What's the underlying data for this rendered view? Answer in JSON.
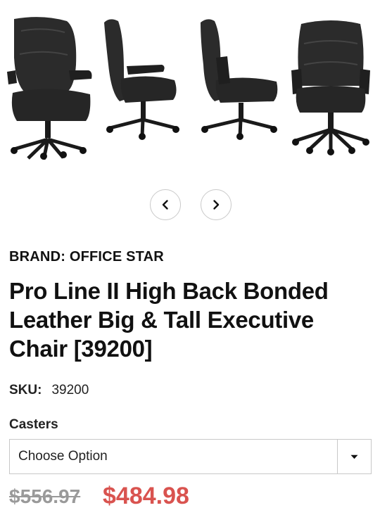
{
  "gallery": {
    "images": [
      {
        "name": "chair-three-quarter-view",
        "alt": "chair image"
      },
      {
        "name": "chair-side-view-right",
        "alt": "chair image"
      },
      {
        "name": "chair-side-view-left",
        "alt": "chair image"
      },
      {
        "name": "chair-front-view",
        "alt": "chair image"
      }
    ],
    "prev_icon": "chevron-left-icon",
    "next_icon": "chevron-right-icon"
  },
  "product": {
    "brand_label": "BRAND: OFFICE STAR",
    "title": "Pro Line II High Back Bonded Leather Big & Tall Executive Chair [39200]",
    "sku_label": "SKU:",
    "sku_value": "39200"
  },
  "options": {
    "casters_label": "Casters",
    "casters_selected": "Choose Option",
    "dropdown_icon": "caret-down-icon"
  },
  "pricing": {
    "original_price": "$556.97",
    "sale_price": "$484.98",
    "sale_color": "#d9534f"
  }
}
